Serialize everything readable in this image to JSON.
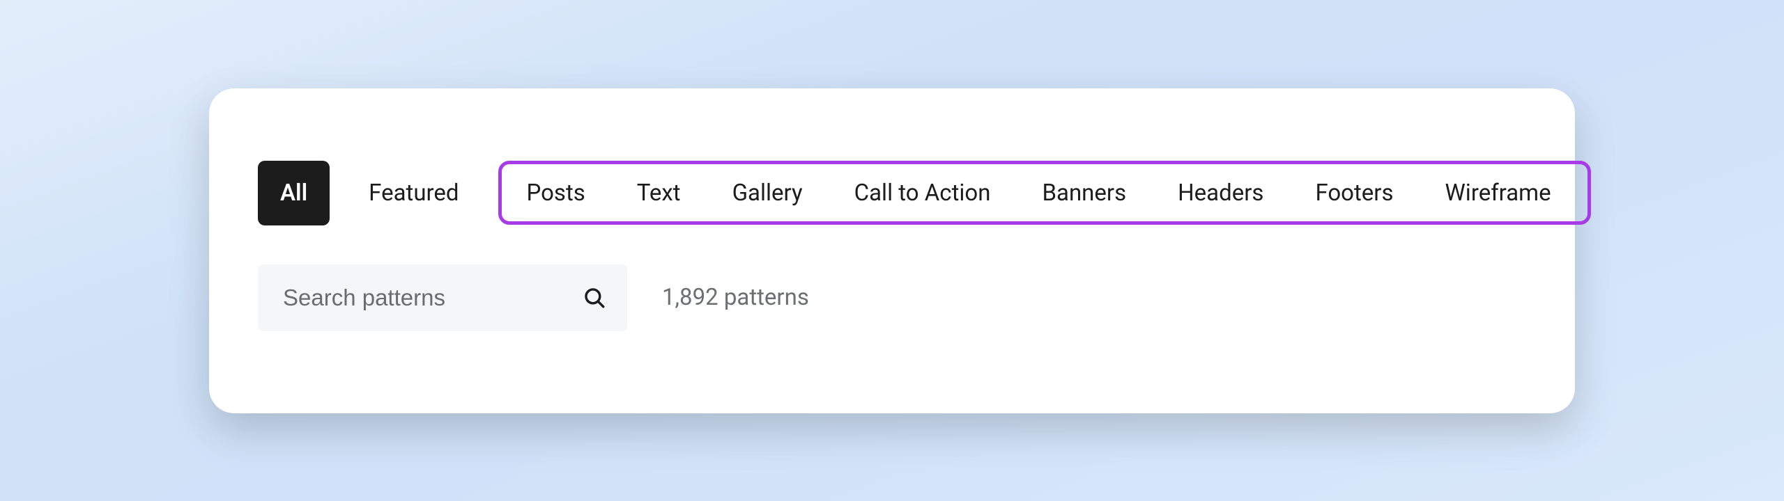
{
  "filters": {
    "active_label": "All",
    "secondary_label": "Featured",
    "highlighted": [
      "Posts",
      "Text",
      "Gallery",
      "Call to Action",
      "Banners",
      "Headers",
      "Footers",
      "Wireframe"
    ]
  },
  "search": {
    "placeholder": "Search patterns",
    "value": ""
  },
  "results": {
    "count_label": "1,892 patterns"
  },
  "colors": {
    "highlight_border": "#a63be7",
    "active_chip_bg": "#1c1c1c"
  }
}
